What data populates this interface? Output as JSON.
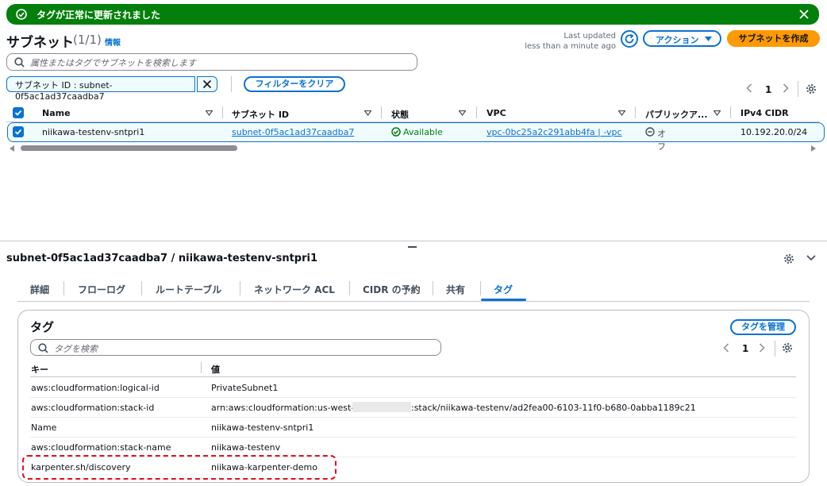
{
  "flash": {
    "message": "タグが正常に更新されました"
  },
  "header": {
    "title": "サブネット",
    "count": "(1/1)",
    "info": "情報",
    "last_updated_label": "Last updated",
    "last_updated_value": "less than a minute ago",
    "actions_label": "アクション",
    "create_label": "サブネットを作成"
  },
  "search": {
    "placeholder": "属性またはタグでサブネットを検索します"
  },
  "filter": {
    "token": "サブネット ID : subnet-0f5ac1ad37caadba7",
    "clear_label": "フィルターをクリア"
  },
  "pagination": {
    "page": "1"
  },
  "table": {
    "columns": [
      "Name",
      "サブネット ID",
      "状態",
      "VPC",
      "パブリックア...",
      "IPv4 CIDR"
    ],
    "row": {
      "name": "niikawa-testenv-sntpri1",
      "subnet_id": "subnet-0f5ac1ad37caadba7",
      "state": "Available",
      "vpc": "vpc-0bc25a2c291abb4fa | -vpc",
      "public": "オフ",
      "cidr": "10.192.20.0/24"
    }
  },
  "detail": {
    "title": "subnet-0f5ac1ad37caadba7 / niikawa-testenv-sntpri1",
    "tabs": [
      "詳細",
      "フローログ",
      "ルートテーブル",
      "ネットワーク ACL",
      "CIDR の予約",
      "共有",
      "タグ"
    ],
    "active_tab": "タグ"
  },
  "tags": {
    "title": "タグ",
    "manage_label": "タグを管理",
    "search_placeholder": "タグを検索",
    "page": "1",
    "key_header": "キー",
    "value_header": "値",
    "rows": [
      {
        "key": "aws:cloudformation:logical-id",
        "value": "PrivateSubnet1"
      },
      {
        "key": "aws:cloudformation:stack-id",
        "value_prefix": "arn:aws:cloudformation:us-west-2:",
        "value_suffix": ":stack/niikawa-testenv/ad2fea00-6103-11f0-b680-0abba1189c21"
      },
      {
        "key": "Name",
        "value": "niikawa-testenv-sntpri1"
      },
      {
        "key": "aws:cloudformation:stack-name",
        "value": "niikawa-testenv"
      },
      {
        "key": "karpenter.sh/discovery",
        "value": "niikawa-karpenter-demo"
      }
    ]
  },
  "colors": {
    "accent": "#0972d3",
    "success": "#037f0c",
    "primary": "#ff9900",
    "highlight": "#e0101e"
  }
}
